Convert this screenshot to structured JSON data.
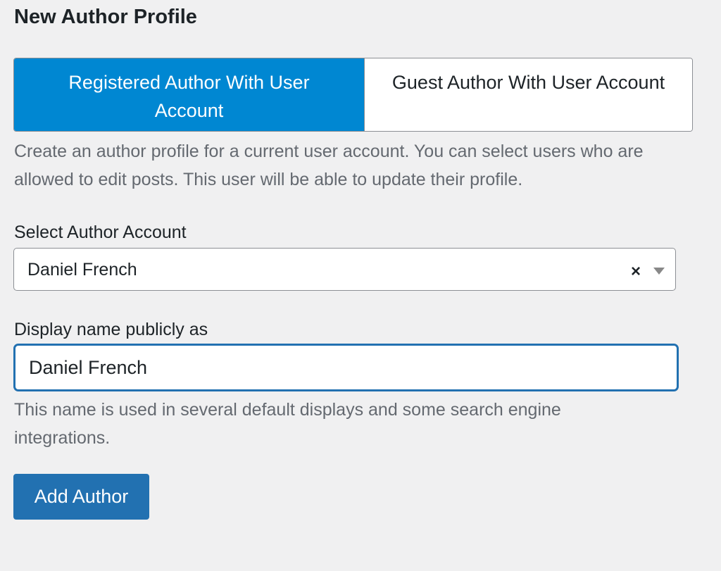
{
  "page": {
    "title": "New Author Profile"
  },
  "tabs": [
    {
      "label": "Registered Author With User Account",
      "active": true
    },
    {
      "label": "Guest Author With User Account",
      "active": false
    }
  ],
  "tab_description": "Create an author profile for a current user account. You can select users who are allowed to edit posts. This user will be able to update their profile.",
  "author_account": {
    "label": "Select Author Account",
    "selected_value": "Daniel French",
    "clear_symbol": "×",
    "icons": [
      "clear-icon",
      "dropdown-arrow-icon"
    ]
  },
  "display_name": {
    "label": "Display name publicly as",
    "value": "Daniel French",
    "description": "This name is used in several default displays and some search engine integrations."
  },
  "actions": {
    "submit_label": "Add Author"
  },
  "colors": {
    "background": "#f0f0f1",
    "active_tab": "#0087d2",
    "primary_button": "#2271b1",
    "focus_border": "#2271b1",
    "muted_text": "#646970"
  }
}
